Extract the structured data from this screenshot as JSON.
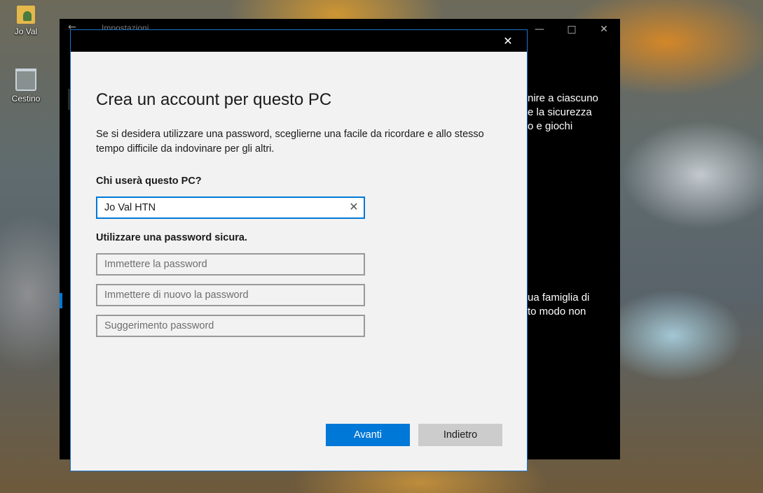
{
  "desktop": {
    "icons": [
      {
        "label": "Jo Val",
        "icon": "user-folder-icon"
      },
      {
        "label": "Cestino",
        "icon": "recycle-bin-icon"
      }
    ]
  },
  "background_window": {
    "title": "Impostazioni",
    "text_lines_top": [
      "nire a ciascuno",
      "e la sicurezza",
      "o e giochi"
    ],
    "text_lines_bottom": [
      "ua famiglia di",
      "to modo non"
    ]
  },
  "dialog": {
    "heading": "Crea un account per questo PC",
    "description": "Se si desidera utilizzare una password, sceglierne una facile da ricordare e allo stesso tempo difficile da indovinare per gli altri.",
    "user_label": "Chi userà questo PC?",
    "username_value": "Jo Val HTN",
    "password_label": "Utilizzare una password sicura.",
    "password_placeholder": "Immettere la password",
    "password_confirm_placeholder": "Immettere di nuovo la password",
    "hint_placeholder": "Suggerimento password",
    "next_button": "Avanti",
    "back_button": "Indietro"
  },
  "colors": {
    "accent": "#0078d7",
    "dialog_bg": "#f2f2f2",
    "titlebar": "#000000"
  }
}
